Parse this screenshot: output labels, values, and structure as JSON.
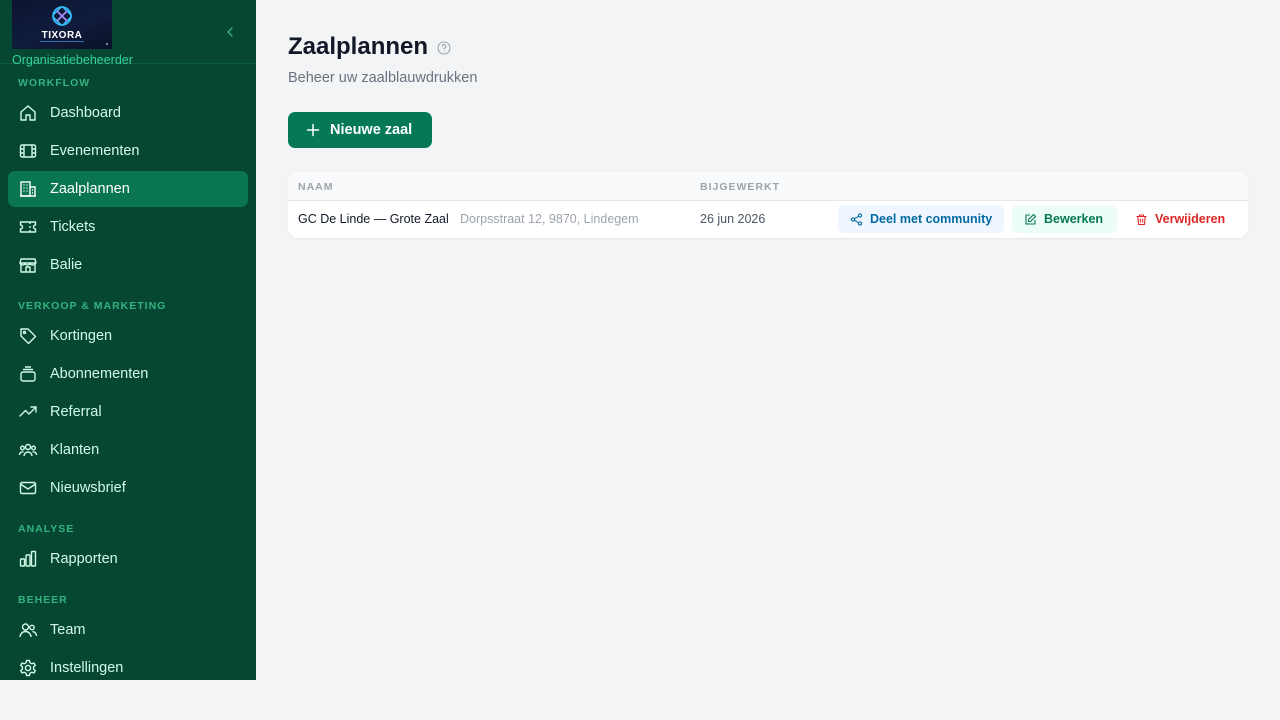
{
  "brand": {
    "logo_text": "TIXORA",
    "role": "Organisatiebeheerder"
  },
  "nav": {
    "sections": [
      {
        "label": "WORKFLOW",
        "items": [
          {
            "label": "Dashboard",
            "icon": "home-icon"
          },
          {
            "label": "Evenementen",
            "icon": "film-icon"
          },
          {
            "label": "Zaalplannen",
            "icon": "building-icon",
            "active": true
          },
          {
            "label": "Tickets",
            "icon": "ticket-icon"
          },
          {
            "label": "Balie",
            "icon": "store-icon"
          }
        ]
      },
      {
        "label": "VERKOOP & MARKETING",
        "items": [
          {
            "label": "Kortingen",
            "icon": "tag-icon"
          },
          {
            "label": "Abonnementen",
            "icon": "layers-icon"
          },
          {
            "label": "Referral",
            "icon": "trending-up-icon"
          },
          {
            "label": "Klanten",
            "icon": "users-group-icon"
          },
          {
            "label": "Nieuwsbrief",
            "icon": "mail-icon"
          }
        ]
      },
      {
        "label": "ANALYSE",
        "items": [
          {
            "label": "Rapporten",
            "icon": "bar-chart-icon"
          }
        ]
      },
      {
        "label": "BEHEER",
        "items": [
          {
            "label": "Team",
            "icon": "users-icon"
          },
          {
            "label": "Instellingen",
            "icon": "gear-icon"
          }
        ]
      }
    ]
  },
  "page": {
    "title": "Zaalplannen",
    "subtitle": "Beheer uw zaalblauwdrukken",
    "new_button": "Nieuwe zaal"
  },
  "table": {
    "headers": {
      "name": "NAAM",
      "updated": "BIJGEWERKT"
    },
    "rows": [
      {
        "name": "GC De Linde — Grote Zaal",
        "address": "Dorpsstraat 12, 9870, Lindegem",
        "updated": "26 jun 2026",
        "actions": {
          "share": "Deel met community",
          "edit": "Bewerken",
          "delete": "Verwijderen"
        }
      }
    ]
  },
  "colors": {
    "sidebar_bg": "#064734",
    "active_item": "#0a7551",
    "primary": "#047857",
    "share": "#0369a1",
    "danger": "#dc2626"
  }
}
